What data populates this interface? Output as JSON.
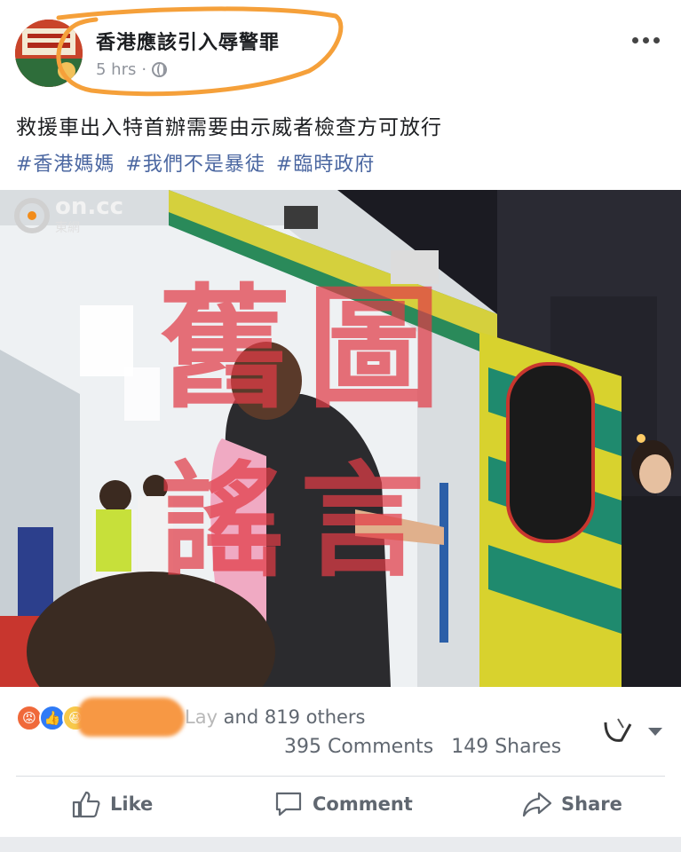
{
  "post": {
    "author": "香港應該引入辱警罪",
    "time": "5 hrs",
    "text": "救援車出入特首辦需要由示威者檢查方可放行",
    "hashtags": [
      "#香港媽媽",
      "#我們不是暴徒",
      "#臨時政府"
    ]
  },
  "image": {
    "watermark_brand": "on.cc",
    "watermark_sub": "東網",
    "stamp_line1": "舊圖",
    "stamp_line2": "謠言"
  },
  "engagement": {
    "reactions": [
      "angry-icon",
      "like-icon",
      "haha-icon"
    ],
    "reaction_names": "Lay",
    "reaction_suffix": " and 819 others",
    "comments": "395 Comments",
    "shares": "149 Shares"
  },
  "actions": {
    "like": "Like",
    "comment": "Comment",
    "share": "Share"
  },
  "colors": {
    "annotation": "#f5a03a",
    "stamp": "#e13c46",
    "hashtag": "#4b67a1"
  }
}
